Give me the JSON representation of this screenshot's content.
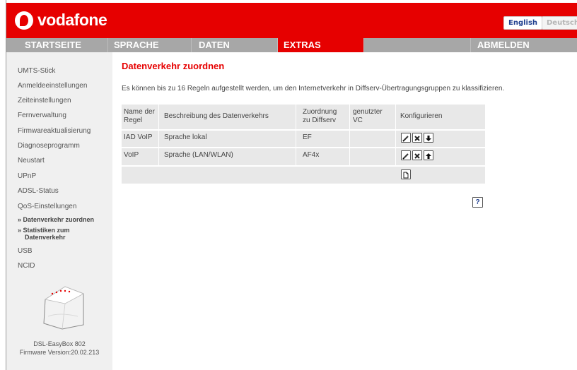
{
  "header": {
    "brand": "vodafone",
    "lang_english": "English",
    "lang_deutsch": "Deutsch"
  },
  "nav": {
    "items": [
      "STARTSEITE",
      "SPRACHE",
      "DATEN",
      "EXTRAS",
      "ABMELDEN"
    ],
    "active": "EXTRAS"
  },
  "sidebar": {
    "items": [
      "UMTS-Stick",
      "Anmeldeeinstellungen",
      "Zeiteinstellungen",
      "Fernverwaltung",
      "Firmwareaktualisierung",
      "Diagnoseprogramm",
      "Neustart",
      "UPnP",
      "ADSL-Status",
      "QoS-Einstellungen"
    ],
    "sub_items": [
      "» Datenverkehr zuordnen",
      "» Statistiken zum",
      "Datenverkehr"
    ],
    "items_after": [
      "USB",
      "NCID"
    ],
    "device_name": "DSL-EasyBox 802",
    "firmware": "Firmware Version:20.02.213"
  },
  "main": {
    "title": "Datenverkehr zuordnen",
    "description": "Es können bis zu 16 Regeln aufgestellt werden, um den Internetverkehr in Diffserv-Übertragungsgruppen zu klassifizieren.",
    "table": {
      "headers": {
        "name_1": "Name der",
        "name_2": "Regel",
        "desc": "Beschreibung des Datenverkehrs",
        "diff_1": "Zuordnung",
        "diff_2": "zu Diffserv",
        "vc_1": "genutzter",
        "vc_2": "VC",
        "config": "Konfigurieren"
      },
      "rows": [
        {
          "name": "IAD VoIP",
          "description": "Sprache lokal",
          "diffserv": "EF",
          "vc": ""
        },
        {
          "name": "VoIP",
          "description": "Sprache (LAN/WLAN)",
          "diffserv": "AF4x",
          "vc": ""
        }
      ]
    },
    "help": "?"
  },
  "colors": {
    "brand_red": "#e60000",
    "nav_gray": "#a7a7a7",
    "sidebar_bg": "#f0f0f0",
    "table_bg": "#e8e8e8"
  },
  "icons": [
    "edit-icon",
    "delete-icon",
    "move-down-icon",
    "move-up-icon",
    "add-rule-icon",
    "help-icon"
  ]
}
